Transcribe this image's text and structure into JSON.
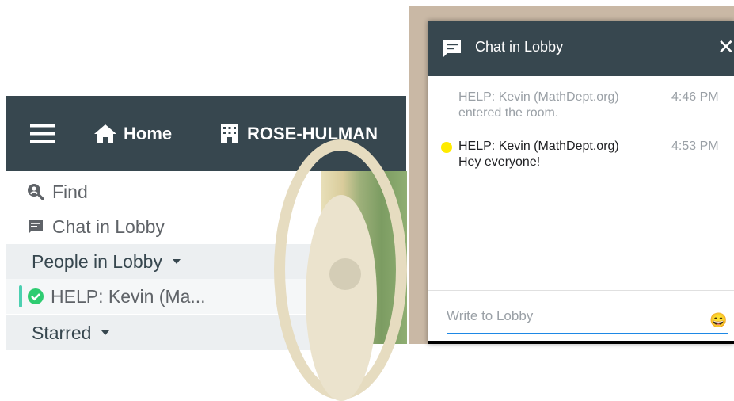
{
  "topbar": {
    "menu_icon": "hamburger-icon",
    "home_label": "Home",
    "home_icon": "home-icon",
    "org_label": "ROSE-HULMAN",
    "org_icon": "building-icon"
  },
  "sidebar": {
    "find_label": "Find",
    "chat_label": "Chat in Lobby",
    "people_section": "People in Lobby",
    "people": [
      {
        "name": "HELP: Kevin (Ma..."
      }
    ],
    "starred_section": "Starred"
  },
  "chat": {
    "title": "Chat in Lobby",
    "close_label": "✕",
    "messages": [
      {
        "who": "HELP: Kevin (MathDept.org)",
        "time": "4:46 PM",
        "body": "entered the room."
      },
      {
        "who": "HELP: Kevin (MathDept.org)",
        "time": "4:53 PM",
        "body": "Hey everyone!"
      }
    ],
    "input_placeholder": "Write to Lobby",
    "emoji": "😄"
  },
  "colors": {
    "header": "#37474f",
    "section_bg": "#eceff1",
    "accent_blue": "#1e88e5",
    "online_green": "#4dd0b1",
    "status_dot": "#ffeb00"
  }
}
